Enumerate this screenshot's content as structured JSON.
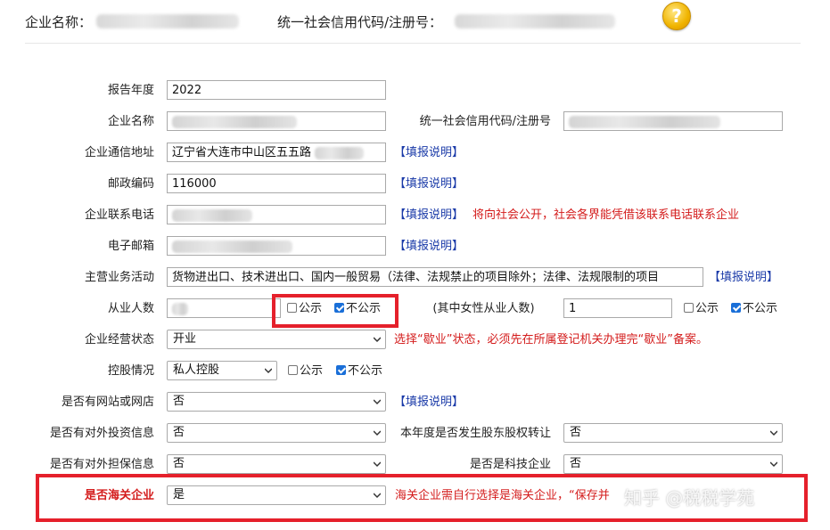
{
  "header": {
    "company_name_label": "企业名称：",
    "credit_code_label": "统一社会信用代码/注册号：",
    "help_icon_symbol": "?"
  },
  "form": {
    "report_year": {
      "label": "报告年度",
      "value": "2022"
    },
    "company_name": {
      "label": "企业名称"
    },
    "credit_code": {
      "label": "统一社会信用代码/注册号"
    },
    "address": {
      "label": "企业通信地址",
      "value": "辽宁省大连市中山区五五路",
      "link": "【填报说明】"
    },
    "postcode": {
      "label": "邮政编码",
      "value": "116000",
      "link": "【填报说明】"
    },
    "phone": {
      "label": "企业联系电话",
      "link": "【填报说明】",
      "note": "将向社会公开，社会各界能凭借该联系电话联系企业"
    },
    "email": {
      "label": "电子邮箱",
      "link": "【填报说明】"
    },
    "business": {
      "label": "主营业务活动",
      "value": "货物进出口、技术进出口、国内一般贸易（法律、法规禁止的项目除外；法律、法规限制的项目",
      "link": "【填报说明】"
    },
    "employees": {
      "label": "从业人数",
      "public": "公示",
      "private": "不公示",
      "public_checked": false,
      "private_checked": true
    },
    "female_employees": {
      "label": "(其中女性从业人数)",
      "value": "1",
      "public": "公示",
      "private": "不公示",
      "public_checked": false,
      "private_checked": true
    },
    "status": {
      "label": "企业经营状态",
      "value": "开业",
      "note": "选择“歇业”状态，必须先在所属登记机关办理完“歇业”备案。"
    },
    "holding": {
      "label": "控股情况",
      "value": "私人控股",
      "public": "公示",
      "private": "不公示",
      "public_checked": false,
      "private_checked": true
    },
    "website": {
      "label": "是否有网站或网店",
      "value": "否",
      "link": "【填报说明】"
    },
    "investment": {
      "label": "是否有对外投资信息",
      "value": "否"
    },
    "equity_transfer": {
      "label": "本年度是否发生股东股权转让",
      "value": "否"
    },
    "guarantee": {
      "label": "是否有对外担保信息",
      "value": "否"
    },
    "tech": {
      "label": "是否是科技企业",
      "value": "否"
    },
    "customs": {
      "label": "是否海关企业",
      "value": "是",
      "note": "海关企业需自行选择是海关企业，“保存并"
    }
  },
  "watermark": "知乎 @税税学苑",
  "colors": {
    "accent_red": "#e5202b",
    "link_blue": "#1a3aa8",
    "note_red": "#d41c1c"
  }
}
